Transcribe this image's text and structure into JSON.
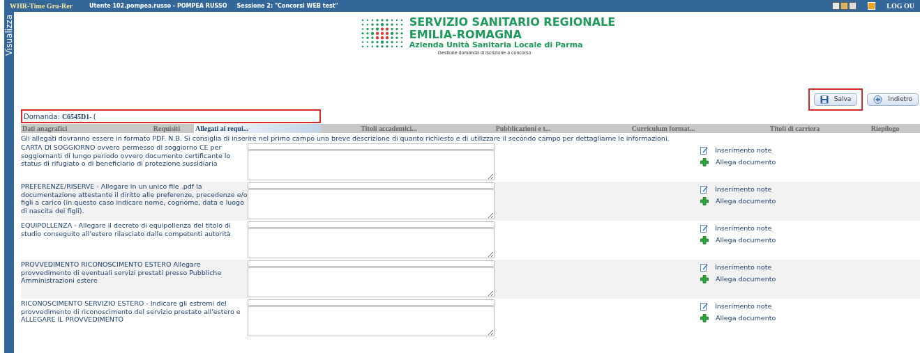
{
  "top_bar": {
    "app": "WHR-Time Gru-Rer",
    "user": "Utente 102.pompea.russo - POMPEA RUSSO",
    "session": "Sessione 2: \"Concorsi WEB test\"",
    "logout": "LOG OU"
  },
  "side_tab": {
    "label": "Visualizza"
  },
  "logo": {
    "line1": "SERVIZIO SANITARIO REGIONALE",
    "line2": "EMILIA-ROMAGNA",
    "line3": "Azienda Unità Sanitaria Locale di Parma",
    "subtitle": "Gestione domanda di iscrizione a concorso"
  },
  "buttons": [
    {
      "kind": "save",
      "label": "Salva",
      "highlighted": true
    },
    {
      "kind": "back",
      "label": "Indietro",
      "highlighted": false
    }
  ],
  "domanda": {
    "label": "Domanda:",
    "code": "C6545D1-",
    "rest": "(",
    "highlighted": true
  },
  "tabs": [
    {
      "label": "Dati anagrafici",
      "selected": false
    },
    {
      "label": "Requisiti",
      "selected": false
    },
    {
      "label": "Allegati ai requi...",
      "selected": true
    },
    {
      "label": "Titoli accademici...",
      "selected": false
    },
    {
      "label": "Pubblicazioni e t...",
      "selected": false
    },
    {
      "label": "Curriculum format...",
      "selected": false
    },
    {
      "label": "Titoli di carriera",
      "selected": false
    },
    {
      "label": "Riepilogo",
      "selected": false
    }
  ],
  "intro": "Gli allegati dovranno essere in formato PDF. N.B. Si consiglia di inserire nel primo campo una breve descrizione di quanto richiesto e di utilizzare il secondo campo per dettagliarne le informazioni.",
  "attachments": [
    {
      "label": "CARTA DI SOGGIORNO ovvero permesso di soggiorno CE per soggiornanti di lungo periodo ovvero documento certificante lo status di rifugiato o di beneficiario di protezione sussidiaria",
      "note": "Inserimento note",
      "attach": "Allega documento"
    },
    {
      "label": "PREFERENZE/RISERVE - Allegare in un unico file .pdf la documentazione attestante il diritto alle preferenze, precedenze e/o figli a carico (in questo caso indicare nome, cognome, data e luogo di nascita dei figli).",
      "note": "Inserimento note",
      "attach": "Allega documento"
    },
    {
      "label": "EQUIPOLLENZA - Allegare il decreto di equipollenza del titolo di studio conseguito all'estero rilasciato dalle competenti autorità",
      "note": "Inserimento note",
      "attach": "Allega documento"
    },
    {
      "label": "PROVVEDIMENTO RICONOSCIMENTO ESTERO Allegare provvedimento di eventuali servizi prestati presso Pubbliche Amministrazioni estere",
      "note": "Inserimento note",
      "attach": "Allega documento"
    },
    {
      "label": "RICONOSCIMENTO SERVIZIO ESTERO - Indicare gli estremi del provvedimento di riconoscimento del servizio prestato all'estero e ALLEGARE IL PROVVEDIMENTO",
      "note": "Inserimento note",
      "attach": "Allega documento"
    }
  ]
}
